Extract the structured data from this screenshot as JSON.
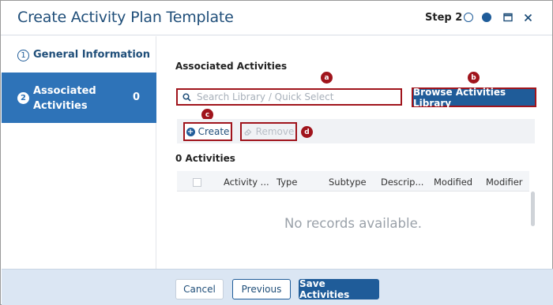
{
  "dialog": {
    "title": "Create Activity Plan Template",
    "step_label": "Step 2"
  },
  "sidebar": {
    "items": [
      {
        "number": "1",
        "label": "General Information",
        "count": ""
      },
      {
        "number": "2",
        "label": "Associated Activities",
        "count": "0"
      }
    ]
  },
  "main": {
    "section_title": "Associated Activities",
    "search": {
      "placeholder": "Search Library / Quick Select",
      "value": ""
    },
    "browse_label": "Browse Activities Library",
    "create_label": "Create",
    "remove_label": "Remove",
    "activities_count_label": "0 Activities",
    "columns": [
      "Activity ...",
      "Type",
      "Subtype",
      "Descrip...",
      "Modified",
      "Modifier"
    ],
    "empty_message": "No records available."
  },
  "callouts": [
    "a",
    "b",
    "c",
    "d"
  ],
  "footer": {
    "cancel_label": "Cancel",
    "previous_label": "Previous",
    "save_label": "Save Activities"
  },
  "colors": {
    "primary": "#1f5c99",
    "sidebar_active": "#2e73b8",
    "callout": "#a0141c",
    "footer_bg": "#dbe6f3"
  }
}
